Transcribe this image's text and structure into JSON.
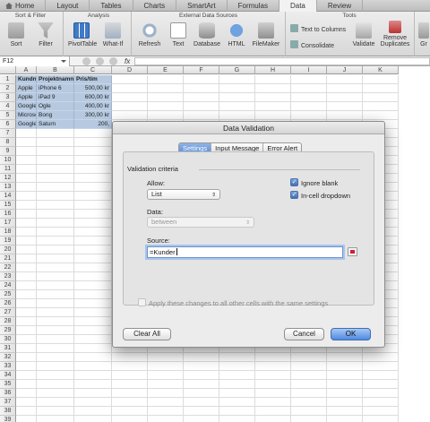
{
  "ribbon_tabs": [
    {
      "label": "Home"
    },
    {
      "label": "Layout"
    },
    {
      "label": "Tables"
    },
    {
      "label": "Charts"
    },
    {
      "label": "SmartArt"
    },
    {
      "label": "Formulas"
    },
    {
      "label": "Data"
    },
    {
      "label": "Review"
    }
  ],
  "groups": {
    "sort_filter": "Sort & Filter",
    "analysis": "Analysis",
    "external": "External Data Sources",
    "tools": "Tools"
  },
  "buttons": {
    "sort": "Sort",
    "filter": "Filter",
    "pivot": "PivotTable",
    "whatif": "What-If",
    "refresh": "Refresh",
    "text": "Text",
    "database": "Database",
    "html": "HTML",
    "filemaker": "FileMaker",
    "text_to_columns": "Text to Columns",
    "consolidate": "Consolidate",
    "validate": "Validate",
    "remove_dup_1": "Remove",
    "remove_dup_2": "Duplicates",
    "gr": "Gr"
  },
  "formula_bar": {
    "cell_ref": "F12",
    "fx": "fx"
  },
  "columns": [
    "A",
    "B",
    "C",
    "D",
    "E",
    "F",
    "G",
    "H",
    "I",
    "J",
    "K"
  ],
  "rows": [
    "1",
    "2",
    "3",
    "4",
    "5",
    "6",
    "7",
    "8",
    "9",
    "10",
    "11",
    "12",
    "13",
    "14",
    "15",
    "16",
    "17",
    "18",
    "19",
    "20",
    "21",
    "22",
    "23",
    "24",
    "25",
    "26",
    "27",
    "28",
    "29",
    "30",
    "31",
    "32",
    "33",
    "34",
    "35",
    "36",
    "37",
    "38",
    "39"
  ],
  "sheet": {
    "headers": [
      "Kundnamn",
      "Projektnamn",
      "Pris/tim"
    ],
    "rows": [
      [
        "Apple",
        "iPhone 6",
        "500,00 kr"
      ],
      [
        "Apple",
        "iPad 9",
        "600,00 kr"
      ],
      [
        "Google",
        "Ogle",
        "400,00 kr"
      ],
      [
        "Microsoft",
        "Bong",
        "300,00 kr"
      ],
      [
        "Google",
        "Saturn",
        "200,"
      ]
    ]
  },
  "dialog": {
    "title": "Data Validation",
    "tabs": [
      "Settings",
      "Input Message",
      "Error Alert"
    ],
    "criteria_title": "Validation criteria",
    "allow_label": "Allow:",
    "allow_value": "List",
    "data_label": "Data:",
    "data_value": "between",
    "ignore_blank": "Ignore blank",
    "in_cell_dropdown": "In-cell dropdown",
    "source_label": "Source:",
    "source_value": "=Kunder",
    "apply_all": "Apply these changes to all other cells with the same settings",
    "clear_all": "Clear All",
    "cancel": "Cancel",
    "ok": "OK"
  }
}
